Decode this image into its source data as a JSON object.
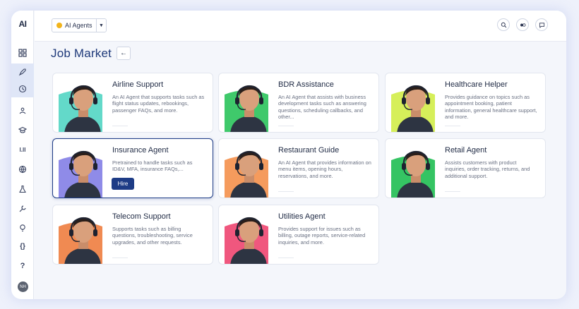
{
  "app": {
    "logo": "AI"
  },
  "agent_selector": {
    "value": "AI Agents"
  },
  "page": {
    "title": "Job Market"
  },
  "sidebar": {
    "icons": [
      "grid-icon",
      "rocket-icon",
      "history-icon",
      "team-icon",
      "graduation-icon",
      "chart-icon",
      "globe-icon",
      "flask-icon",
      "wrench-icon",
      "bulb-icon",
      "code-icon"
    ],
    "help_label": "?",
    "code_label": "{}",
    "bars_label": "l.ll",
    "avatar_initials": "NH"
  },
  "colors": {
    "accent": "#1e3c86",
    "title": "#1f3a7a",
    "selector_dot": "#f2b41b"
  },
  "agents": [
    {
      "title": "Airline Support",
      "description": "An AI Agent that supports tasks such as flight status updates, rebookings, passenger FAQs, and more.",
      "bg": "#63d9c9"
    },
    {
      "title": "BDR Assistance",
      "description": "An AI Agent that assists with business development tasks such as answering questions, scheduling callbacks, and other...",
      "bg": "#3fc96b"
    },
    {
      "title": "Healthcare Helper",
      "description": "Provides guidance on topics such as appointment booking, patient information, general healthcare support, and more.",
      "bg": "#d6ef5a"
    },
    {
      "title": "Insurance Agent",
      "description": "Pretrained to handle tasks such as ID&V, MFA, insurance FAQs,...",
      "bg": "#8f8be8",
      "hire_label": "Hire"
    },
    {
      "title": "Restaurant Guide",
      "description": "An AI Agent that provides information on menu items, opening hours, reservations, and more.",
      "bg": "#f59b5d"
    },
    {
      "title": "Retail Agent",
      "description": "Assists customers with product inquiries, order tracking, returns, and additional support.",
      "bg": "#35c463"
    },
    {
      "title": "Telecom Support",
      "description": "Supports tasks such as billing questions, troubleshooting, service upgrades, and other requests.",
      "bg": "#f08a52"
    },
    {
      "title": "Utilities Agent",
      "description": "Provides support for issues such as billing, outage reports, service-related inquiries, and more.",
      "bg": "#f0577e"
    }
  ]
}
